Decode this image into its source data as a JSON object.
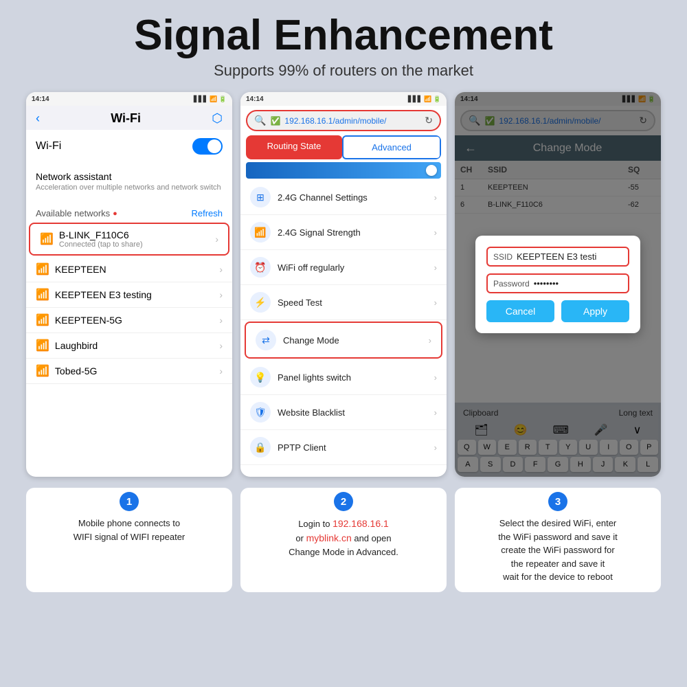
{
  "header": {
    "title": "Signal Enhancement",
    "subtitle": "Supports 99% of routers on the market"
  },
  "phone1": {
    "status_bar": {
      "time": "14:14",
      "network": "3/4G"
    },
    "title": "Wi-Fi",
    "wifi_label": "Wi-Fi",
    "network_assistant_title": "Network assistant",
    "network_assistant_subtitle": "Acceleration over multiple networks and network switch",
    "available_networks": "Available networks",
    "refresh": "Refresh",
    "connected_network": {
      "name": "B-LINK_F110C6",
      "status": "Connected (tap to share)"
    },
    "other_networks": [
      "KEEPTEEN",
      "KEEPTEEN E3 testing",
      "KEEPTEEN-5G",
      "Laughbird",
      "Tobed-5G"
    ]
  },
  "phone2": {
    "status_bar": {
      "time": "14:14"
    },
    "url": "192.168.16.1/admin/mobile/",
    "tab_routing": "Routing State",
    "tab_advanced": "Advanced",
    "menu_items": [
      {
        "name": "2.4G Channel Settings",
        "icon": "⊞"
      },
      {
        "name": "2.4G Signal Strength",
        "icon": "📶"
      },
      {
        "name": "WiFi off regularly",
        "icon": "⏰"
      },
      {
        "name": "Speed Test",
        "icon": "🚀"
      },
      {
        "name": "Change Mode",
        "icon": "⇄"
      },
      {
        "name": "Panel lights switch",
        "icon": "💡"
      },
      {
        "name": "Website Blacklist",
        "icon": "🛡"
      },
      {
        "name": "PPTP Client",
        "icon": "🔒"
      }
    ]
  },
  "phone3": {
    "status_bar": {
      "time": "14:14"
    },
    "url": "192.168.16.1/admin/mobile/",
    "topbar_back": "←",
    "topbar_title": "Change Mode",
    "table_headers": [
      "CH",
      "SSID",
      "SQ"
    ],
    "modal": {
      "ssid_label": "SSID",
      "ssid_value": "KEEPTEEN E3 testi",
      "password_label": "Password",
      "password_value": "••••••••",
      "cancel_btn": "Cancel",
      "apply_btn": "Apply"
    },
    "clipboard_label": "Clipboard",
    "long_text_label": "Long text",
    "keyboard_rows": [
      [
        "Q",
        "W",
        "E",
        "R",
        "T",
        "Y",
        "U",
        "I",
        "O",
        "P"
      ],
      [
        "A",
        "S",
        "D",
        "F",
        "G",
        "H",
        "J",
        "K",
        "L"
      ]
    ]
  },
  "steps": [
    {
      "number": "1",
      "text": "Mobile phone connects to WIFI signal of WIFI repeater"
    },
    {
      "number": "2",
      "text_before": "Login to ",
      "highlight1": "192.168.16.1",
      "text_middle": "\nor ",
      "highlight2": "myblink.cn",
      "text_after": " and open\nChange Mode in Advanced."
    },
    {
      "number": "3",
      "text": "Select the desired WiFi, enter\nthe WiFi password and save it\ncreate the WiFi password for\nthe repeater and save it\nwait for the device to reboot"
    }
  ]
}
